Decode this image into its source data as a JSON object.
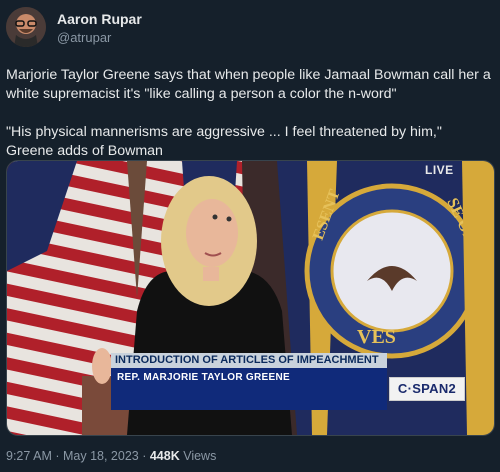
{
  "author": {
    "name": "Aaron Rupar",
    "handle": "@atrupar"
  },
  "tweet": {
    "paragraph1": "Marjorie Taylor Greene says that when people like Jamaal Bowman call her a white supremacist it's \"like calling a person a color the n-word\"",
    "paragraph2": "\"His physical mannerisms are aggressive ... I feel threatened by him,\" Greene adds of Bowman"
  },
  "media": {
    "live_badge": "LIVE",
    "chyron_title": "INTRODUCTION OF ARTICLES OF IMPEACHMENT",
    "chyron_name": "REP. MARJORIE TAYLOR GREENE",
    "network_logo": "C·SPAN2",
    "seal_text_left": "ESENT",
    "seal_text_right": "SE OF",
    "seal_text_bottom": "VES",
    "colors": {
      "flag_red": "#b0202a",
      "flag_navy": "#1f2b5e",
      "chyron_blue": "#102a7a"
    }
  },
  "meta": {
    "time": "9:27 AM",
    "separator1": " · ",
    "date": "May 18, 2023",
    "separator2": " · ",
    "views_count": "448K",
    "views_label": " Views"
  }
}
